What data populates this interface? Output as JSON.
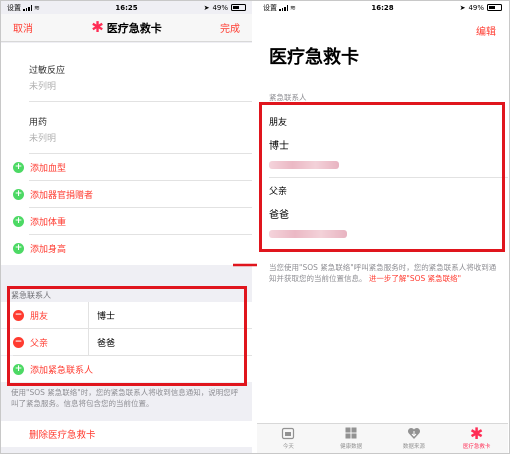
{
  "status_left": {
    "carrier": "设置",
    "time": "16:25",
    "battery": "49%"
  },
  "status_right": {
    "carrier": "设置",
    "time": "16:28",
    "battery": "49%"
  },
  "left": {
    "nav": {
      "cancel": "取消",
      "title": "医疗急救卡",
      "done": "完成"
    },
    "fields": [
      {
        "label": "过敏反应",
        "value": "未列明"
      },
      {
        "label": "用药",
        "value": "未列明"
      }
    ],
    "add_items": [
      "添加血型",
      "添加器官捐赠者",
      "添加体重",
      "添加身高"
    ],
    "emergency_header": "紧急联系人",
    "contacts": [
      {
        "relation": "朋友",
        "name": "博士"
      },
      {
        "relation": "父亲",
        "name": "爸爸"
      }
    ],
    "add_contact": "添加紧急联系人",
    "footnote": "使用\"SOS 紧急联络\"时，您的紧急联系人将收到信息通知，说明您呼叫了紧急服务。信息将包含您的当前位置。",
    "delete": "删除医疗急救卡"
  },
  "right": {
    "edit": "编辑",
    "title": "医疗急救卡",
    "emergency_header": "紧急联系人",
    "contacts": [
      {
        "relation": "朋友",
        "name": "博士"
      },
      {
        "relation": "父亲",
        "name": "爸爸"
      }
    ],
    "footnote": "当您使用\"SOS 紧急联络\"呼叫紧急服务时，您的紧急联系人将收到通知并获取您的当前位置信息。",
    "footnote_link": "进一步了解\"SOS 紧急联络\"",
    "tabs": [
      {
        "label": "今天",
        "icon": "calendar-icon"
      },
      {
        "label": "健康数据",
        "icon": "grid-icon"
      },
      {
        "label": "数据来源",
        "icon": "heart-download-icon"
      },
      {
        "label": "医疗急救卡",
        "icon": "medical-star-icon",
        "active": true
      }
    ]
  },
  "colors": {
    "accent": "#ff3b30",
    "highlight": "#e0151d",
    "add_green": "#4cd964"
  }
}
